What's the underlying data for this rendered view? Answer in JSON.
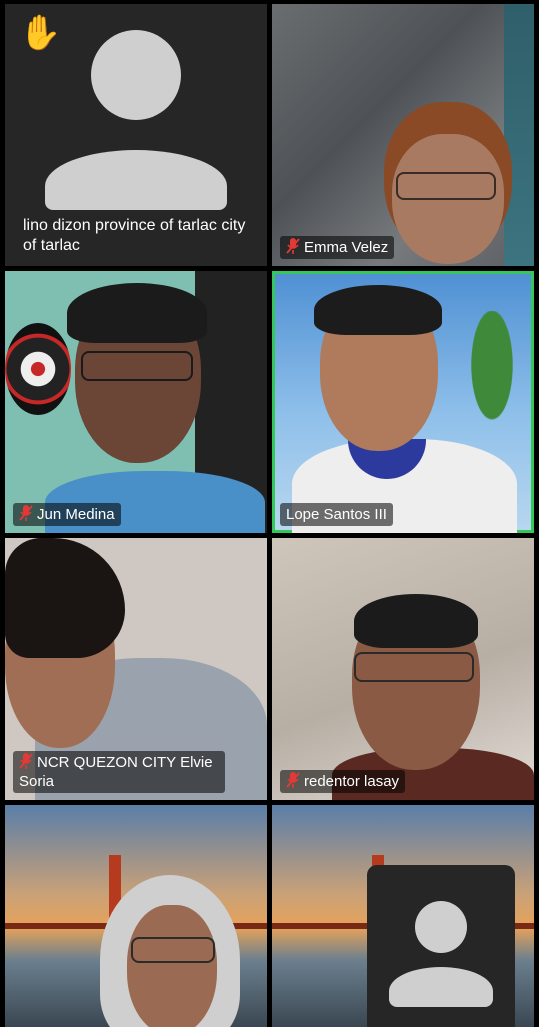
{
  "tiles": [
    {
      "name": "lino dizon province of tarlac city of tarlac",
      "muted": false,
      "raised_hand": true,
      "camera_off": true
    },
    {
      "name": "Emma Velez",
      "muted": true
    },
    {
      "name": "Jun Medina",
      "muted": true
    },
    {
      "name": "Lope Santos III",
      "muted": false,
      "active_speaker": true
    },
    {
      "name": "NCR QUEZON CITY Elvie Soria",
      "muted": true
    },
    {
      "name": "redentor lasay",
      "muted": true
    },
    {
      "name": "",
      "muted": false
    },
    {
      "name": "",
      "muted": false,
      "camera_off": true
    }
  ],
  "icons": {
    "raised_hand": "raised-hand-icon",
    "muted": "mic-muted-icon",
    "avatar": "person-placeholder-icon"
  },
  "colors": {
    "active_border": "#35c759",
    "muted_icon": "#e53935",
    "avatar": "#cfcfcf"
  }
}
